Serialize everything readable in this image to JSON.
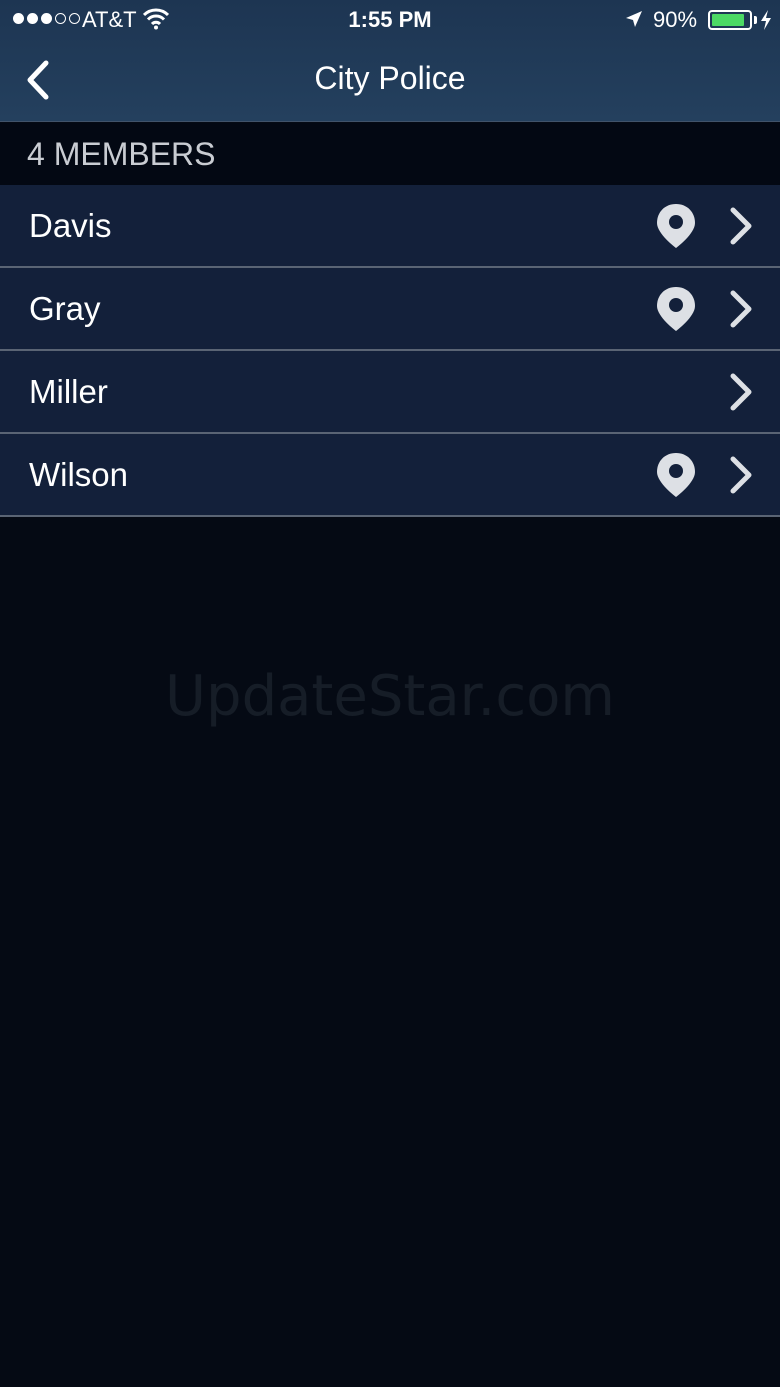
{
  "status_bar": {
    "carrier": "AT&T",
    "time": "1:55 PM",
    "battery_percent": "90%",
    "battery_level": 0.9,
    "signal_bars_filled": 3,
    "signal_bars_total": 5
  },
  "nav": {
    "title": "City Police",
    "back_icon": "chevron-left-icon"
  },
  "section": {
    "header": "4 MEMBERS"
  },
  "members": [
    {
      "name": "Davis",
      "has_location": true
    },
    {
      "name": "Gray",
      "has_location": true
    },
    {
      "name": "Miller",
      "has_location": false
    },
    {
      "name": "Wilson",
      "has_location": true
    }
  ],
  "watermark": "UpdateStar.com",
  "colors": {
    "header_bg": "#24405e",
    "row_bg": "#13203a",
    "page_bg": "#050a14",
    "battery": "#4cd964"
  }
}
